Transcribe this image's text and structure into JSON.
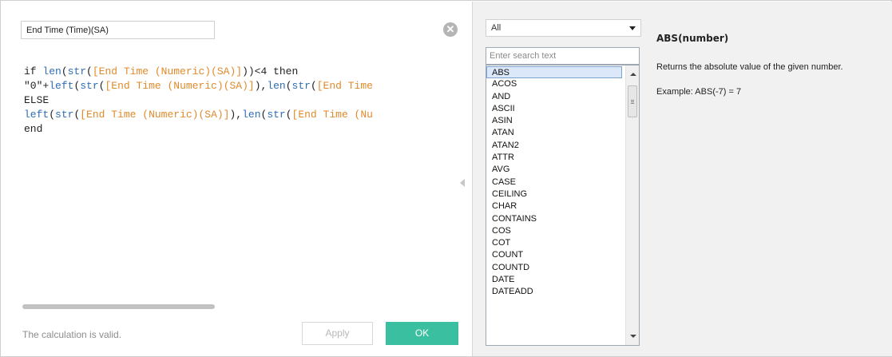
{
  "editor": {
    "calc_name": "End Time (Time)(SA)",
    "close_symbol": "✕",
    "code_lines": [
      [
        {
          "t": "if ",
          "c": "kw"
        },
        {
          "t": "len",
          "c": "fn"
        },
        {
          "t": "(",
          "c": "kw"
        },
        {
          "t": "str",
          "c": "fn"
        },
        {
          "t": "(",
          "c": "kw"
        },
        {
          "t": "[End Time (Numeric)(SA)]",
          "c": "fld"
        },
        {
          "t": "))<4 then",
          "c": "kw"
        }
      ],
      [
        {
          "t": "\"0\"+",
          "c": "str"
        },
        {
          "t": "left",
          "c": "fn"
        },
        {
          "t": "(",
          "c": "kw"
        },
        {
          "t": "str",
          "c": "fn"
        },
        {
          "t": "(",
          "c": "kw"
        },
        {
          "t": "[End Time (Numeric)(SA)]",
          "c": "fld"
        },
        {
          "t": "),",
          "c": "kw"
        },
        {
          "t": "len",
          "c": "fn"
        },
        {
          "t": "(",
          "c": "kw"
        },
        {
          "t": "str",
          "c": "fn"
        },
        {
          "t": "(",
          "c": "kw"
        },
        {
          "t": "[End Time",
          "c": "fld"
        }
      ],
      [
        {
          "t": "ELSE",
          "c": "kw"
        }
      ],
      [
        {
          "t": "left",
          "c": "fn"
        },
        {
          "t": "(",
          "c": "kw"
        },
        {
          "t": "str",
          "c": "fn"
        },
        {
          "t": "(",
          "c": "kw"
        },
        {
          "t": "[End Time (Numeric)(SA)]",
          "c": "fld"
        },
        {
          "t": "),",
          "c": "kw"
        },
        {
          "t": "len",
          "c": "fn"
        },
        {
          "t": "(",
          "c": "kw"
        },
        {
          "t": "str",
          "c": "fn"
        },
        {
          "t": "(",
          "c": "kw"
        },
        {
          "t": "[End Time (Nu",
          "c": "fld"
        }
      ],
      [
        {
          "t": "end",
          "c": "kw"
        }
      ]
    ],
    "status_text": "The calculation is valid.",
    "apply_label": "Apply",
    "ok_label": "OK"
  },
  "reference": {
    "category_selected": "All",
    "search_placeholder": "Enter search text",
    "functions": [
      "ABS",
      "ACOS",
      "AND",
      "ASCII",
      "ASIN",
      "ATAN",
      "ATAN2",
      "ATTR",
      "AVG",
      "CASE",
      "CEILING",
      "CHAR",
      "CONTAINS",
      "COS",
      "COT",
      "COUNT",
      "COUNTD",
      "DATE",
      "DATEADD"
    ],
    "selected_function": "ABS",
    "doc_signature": "ABS(number)",
    "doc_description": "Returns the absolute value of the given number.",
    "doc_example": "Example: ABS(-7) = 7"
  },
  "colors": {
    "ok_button": "#3ac0a0",
    "function_token": "#2f6eb5",
    "field_token": "#e08a2c"
  }
}
